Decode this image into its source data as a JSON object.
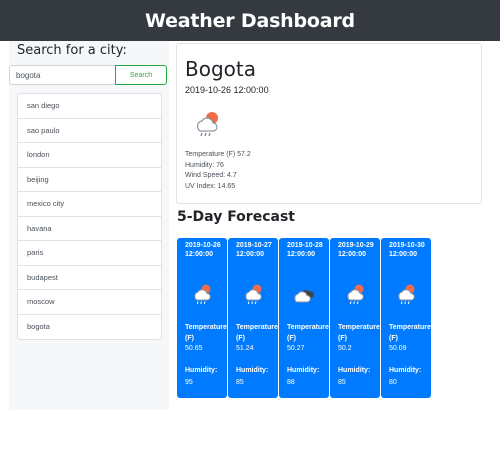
{
  "header": {
    "title": "Weather Dashboard"
  },
  "sidebar": {
    "search_title": "Search for a city:",
    "search_value": "bogota",
    "search_button": "Search",
    "cities": [
      "san diego",
      "sao paulo",
      "london",
      "beijing",
      "mexico city",
      "havana",
      "paris",
      "budapest",
      "moscow",
      "bogota"
    ]
  },
  "current": {
    "city": "Bogota",
    "date": "2019-10-26 12:00:00",
    "icon": "rain-cloud-sun-icon",
    "temperature": "Temperature (F) 57.2",
    "humidity": "Humidity: 76",
    "wind": "Wind Speed: 4.7",
    "uv": "UV Index: 14.65"
  },
  "forecast": {
    "title": "5-Day Forecast",
    "temp_label": "Temperature (F)",
    "hum_label": "Humidity:",
    "days": [
      {
        "date": "2019-10-26 12:00:00",
        "icon": "rain-cloud-sun-icon",
        "temp": "50.65",
        "humidity": "95"
      },
      {
        "date": "2019-10-27 12:00:00",
        "icon": "rain-cloud-sun-icon",
        "temp": "51.24",
        "humidity": "85"
      },
      {
        "date": "2019-10-28 12:00:00",
        "icon": "cloudy-icon",
        "temp": "50.27",
        "humidity": "88"
      },
      {
        "date": "2019-10-29 12:00:00",
        "icon": "rain-cloud-sun-icon",
        "temp": "50.2",
        "humidity": "85"
      },
      {
        "date": "2019-10-30 12:00:00",
        "icon": "rain-cloud-sun-icon",
        "temp": "50.09",
        "humidity": "80"
      }
    ]
  },
  "colors": {
    "header": "#343a40",
    "forecast_card": "#007bff",
    "search_button": "#28a745"
  }
}
